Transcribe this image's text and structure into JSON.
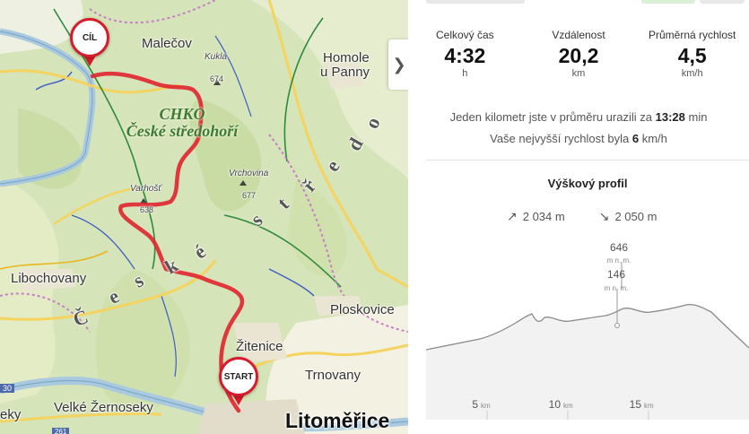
{
  "map": {
    "labels": {
      "malecov": "Malečov",
      "kukla": "Kukla",
      "kukla_elev": "674",
      "homole": "Homole",
      "upanny": "u Panny",
      "chko1": "CHKO",
      "chko2": "České středohoří",
      "vrchovina": "Vrchovina",
      "vrchovina_elev": "677",
      "varhost": "Varhošť",
      "varhost_elev": "638",
      "libochovany": "Libochovany",
      "ploskovice": "Ploskovice",
      "zitenice": "Žitenice",
      "trnovany": "Trnovany",
      "velke_zernoseky": "Velké Žernoseky",
      "eky": "eky",
      "litomerice": "Litoměřice",
      "road30": "30",
      "road261": "261",
      "region_letters": [
        "Č",
        "e",
        "s",
        "k",
        "é",
        "s",
        "t",
        "ř",
        "e",
        "d",
        "o"
      ]
    },
    "pins": {
      "finish": "CÍL",
      "start": "START"
    },
    "collapse_icon": "chevron-right-icon",
    "collapse_glyph": "❯"
  },
  "stats": {
    "time": {
      "label": "Celkový čas",
      "value": "4:32",
      "unit": "h"
    },
    "distance": {
      "label": "Vzdálenost",
      "value": "20,2",
      "unit": "km"
    },
    "speed": {
      "label": "Průměrná rychlost",
      "value": "4,5",
      "unit": "km/h"
    }
  },
  "pace": {
    "line1_prefix": "Jeden kilometr jste v průměru urazili za",
    "line1_value": "13:28",
    "line1_suffix": "min",
    "line2_prefix": "Vaše nejvyšší rychlost byla",
    "line2_value": "6",
    "line2_suffix": "km/h"
  },
  "profile": {
    "title": "Výškový profil",
    "ascent": "2 034 m",
    "descent": "2 050 m",
    "max_value": "646",
    "max_unit": "m n. m.",
    "min_value": "146",
    "min_unit": "m n. m.",
    "x_ticks": [
      {
        "value": "5",
        "unit": "km"
      },
      {
        "value": "10",
        "unit": "km"
      },
      {
        "value": "15",
        "unit": "km"
      }
    ]
  },
  "colors": {
    "route": "#e0242f",
    "pin_border": "#d81b2b",
    "profile_fill": "#f2f2f2",
    "profile_line": "#8a8a8a"
  }
}
